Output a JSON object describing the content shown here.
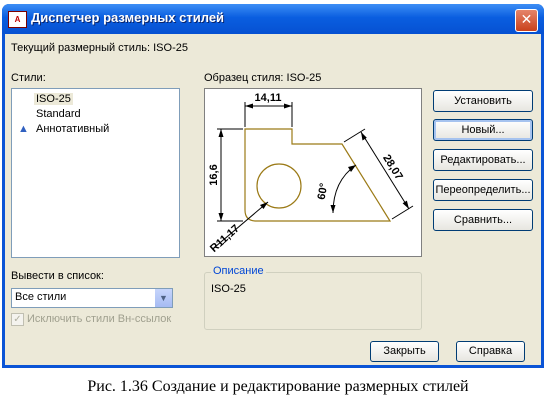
{
  "window": {
    "title": "Диспетчер размерных стилей",
    "app_icon_text": "A"
  },
  "current_style": "Текущий размерный стиль: ISO-25",
  "styles": {
    "label": "Стили:",
    "items": [
      {
        "label": "ISO-25",
        "selected": true,
        "annotative": false
      },
      {
        "label": "Standard",
        "selected": false,
        "annotative": false
      },
      {
        "label": "Аннотативный",
        "selected": false,
        "annotative": true
      }
    ]
  },
  "preview": {
    "label": "Образец стиля: ISO-25",
    "dims": {
      "top": "14,11",
      "left": "16,6",
      "right": "28,07",
      "angle": "60°",
      "radius": "R11,17"
    }
  },
  "buttons": {
    "set": "Установить",
    "new": "Новый...",
    "edit": "Редактировать...",
    "override": "Переопределить...",
    "compare": "Сравнить..."
  },
  "list_filter": {
    "label": "Вывести в список:",
    "value": "Все стили"
  },
  "exclude_xref": {
    "label": "Исключить стили Вн-ссылок",
    "checked": true
  },
  "description": {
    "legend": "Описание",
    "text": "ISO-25"
  },
  "footer": {
    "close": "Закрыть",
    "help": "Справка"
  },
  "caption": "Рис. 1.36 Создание и редактирование размерных стилей"
}
